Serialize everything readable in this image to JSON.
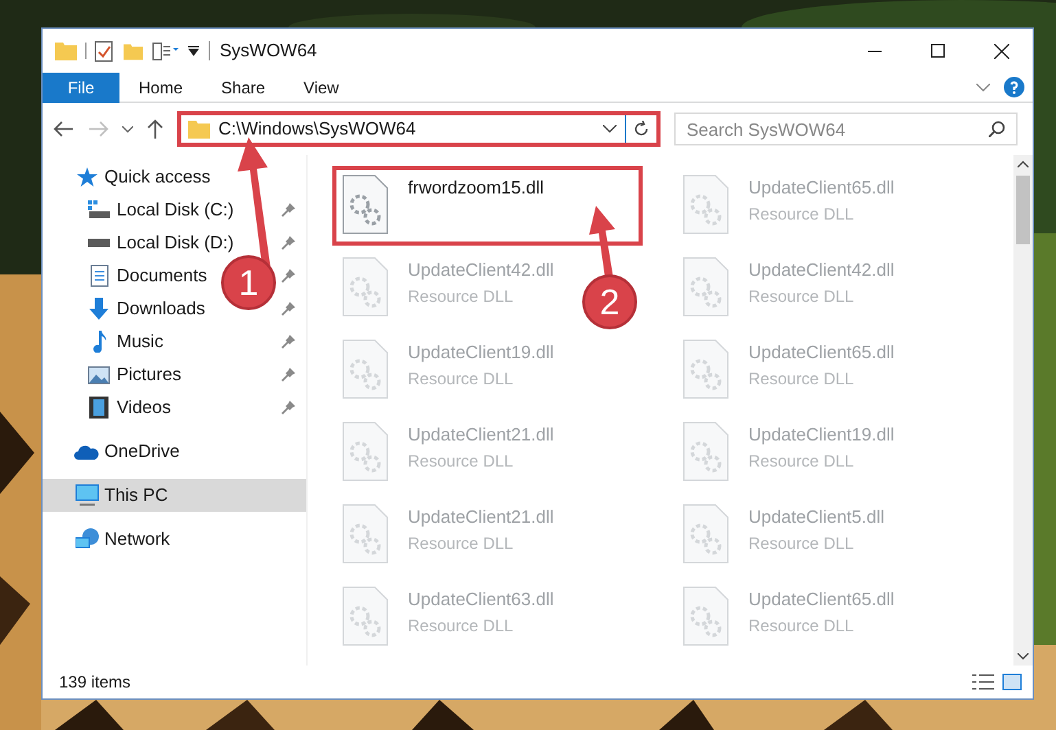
{
  "window": {
    "title": "SysWOW64"
  },
  "ribbon_tabs": [
    {
      "label": "File",
      "kind": "menu"
    },
    {
      "label": "Home",
      "kind": "tab"
    },
    {
      "label": "Share",
      "kind": "tab"
    },
    {
      "label": "View",
      "kind": "tab"
    }
  ],
  "address_bar": {
    "path": "C:\\Windows\\SysWOW64",
    "highlighted": true
  },
  "search": {
    "placeholder": "Search SysWOW64"
  },
  "nav": [
    {
      "label": "Quick access",
      "selected": false,
      "children": [
        {
          "label": "Local Disk (C:)",
          "pinned": true
        },
        {
          "label": "Local Disk (D:)",
          "pinned": true
        },
        {
          "label": "Documents",
          "pinned": true
        },
        {
          "label": "Downloads",
          "pinned": true
        },
        {
          "label": "Music",
          "pinned": true
        },
        {
          "label": "Pictures",
          "pinned": true
        },
        {
          "label": "Videos",
          "pinned": true
        }
      ]
    },
    {
      "label": "OneDrive",
      "selected": false
    },
    {
      "label": "This PC",
      "selected": true
    },
    {
      "label": "Network",
      "selected": false
    }
  ],
  "files": [
    {
      "name": "frwordzoom15.dll",
      "highlighted": true,
      "faded": false
    },
    {
      "name": "UpdateClient65.dll",
      "type": "Resource DLL",
      "highlighted": false,
      "faded": true
    },
    {
      "name": "UpdateClient42.dll",
      "type": "Resource DLL",
      "highlighted": false,
      "faded": true
    },
    {
      "name": "UpdateClient42.dll",
      "type": "Resource DLL",
      "highlighted": false,
      "faded": true
    },
    {
      "name": "UpdateClient19.dll",
      "type": "Resource DLL",
      "highlighted": false,
      "faded": true
    },
    {
      "name": "UpdateClient65.dll",
      "type": "Resource DLL",
      "highlighted": false,
      "faded": true
    },
    {
      "name": "UpdateClient21.dll",
      "type": "Resource DLL",
      "highlighted": false,
      "faded": true
    },
    {
      "name": "UpdateClient19.dll",
      "type": "Resource DLL",
      "highlighted": false,
      "faded": true
    },
    {
      "name": "UpdateClient21.dll",
      "type": "Resource DLL",
      "highlighted": false,
      "faded": true
    },
    {
      "name": "UpdateClient5.dll",
      "type": "Resource DLL",
      "highlighted": false,
      "faded": true
    },
    {
      "name": "UpdateClient63.dll",
      "type": "Resource DLL",
      "highlighted": false,
      "faded": true
    },
    {
      "name": "UpdateClient65.dll",
      "type": "Resource DLL",
      "highlighted": false,
      "faded": true
    }
  ],
  "status_bar": {
    "item_count": "139 items"
  },
  "annotations": [
    {
      "number": "1"
    },
    {
      "number": "2"
    }
  ]
}
